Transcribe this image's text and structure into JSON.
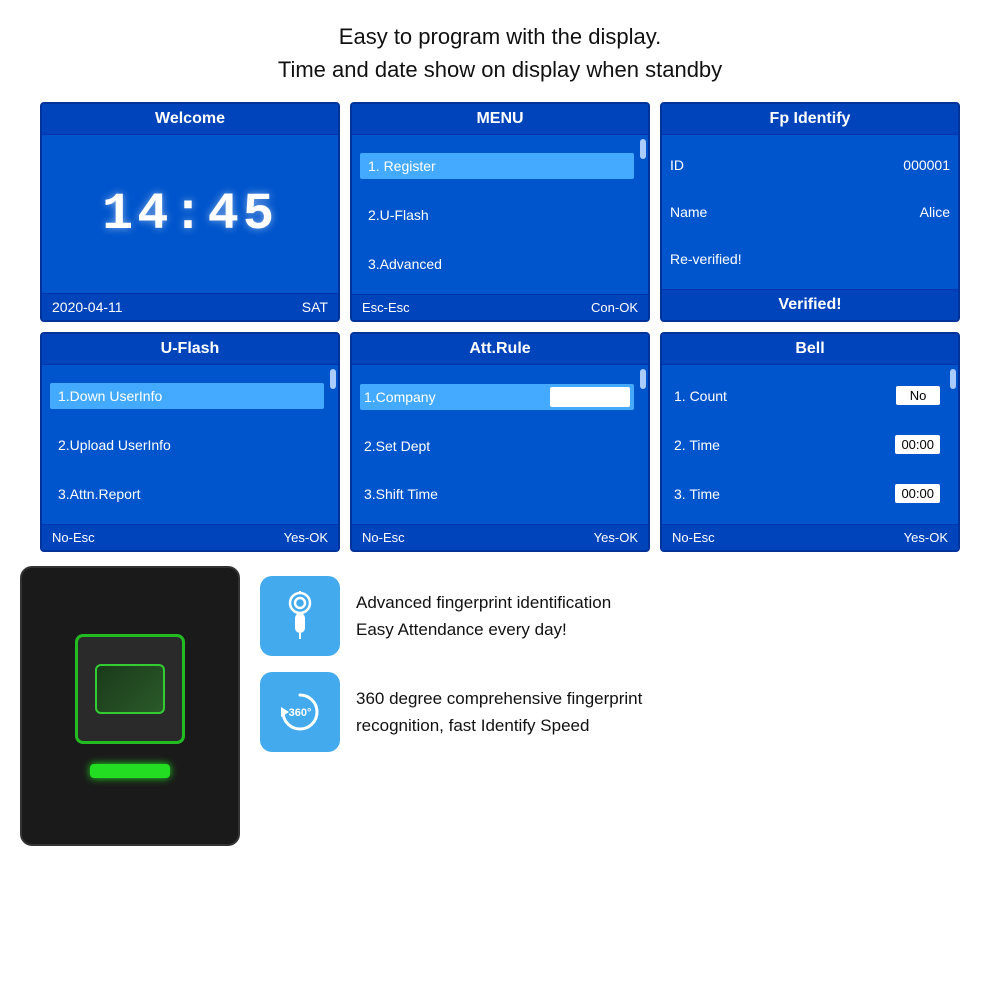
{
  "header": {
    "line1": "Easy to program with the display.",
    "line2": "Time and date show on display when standby"
  },
  "screens": {
    "welcome": {
      "title": "Welcome",
      "clock": "14:45",
      "date": "2020-04-11",
      "day": "SAT"
    },
    "menu": {
      "title": "MENU",
      "items": [
        "1. Register",
        "2.U-Flash",
        "3.Advanced"
      ],
      "footer_left": "Esc-Esc",
      "footer_right": "Con-OK"
    },
    "fp_identify": {
      "title": "Fp Identify",
      "id_label": "ID",
      "id_value": "000001",
      "name_label": "Name",
      "name_value": "Alice",
      "reverified": "Re-verified!",
      "verified": "Verified!"
    },
    "uflash": {
      "title": "U-Flash",
      "items": [
        "1.Down UserInfo",
        "2.Upload UserInfo",
        "3.Attn.Report"
      ],
      "footer_left": "No-Esc",
      "footer_right": "Yes-OK"
    },
    "att_rule": {
      "title": "Att.Rule",
      "items": [
        "1.Company",
        "2.Set Dept",
        "3.Shift Time"
      ],
      "footer_left": "No-Esc",
      "footer_right": "Yes-OK"
    },
    "bell": {
      "title": "Bell",
      "items": [
        {
          "label": "1. Count",
          "value": "No"
        },
        {
          "label": "2. Time",
          "value": "00:00"
        },
        {
          "label": "3. Time",
          "value": "00:00"
        }
      ],
      "footer_left": "No-Esc",
      "footer_right": "Yes-OK"
    }
  },
  "features": [
    {
      "icon": "finger-touch",
      "text_line1": "Advanced fingerprint identification",
      "text_line2": "Easy Attendance every day!"
    },
    {
      "icon": "360-rotate",
      "text_line1": "360 degree comprehensive fingerprint",
      "text_line2": "recognition, fast Identify Speed"
    }
  ]
}
